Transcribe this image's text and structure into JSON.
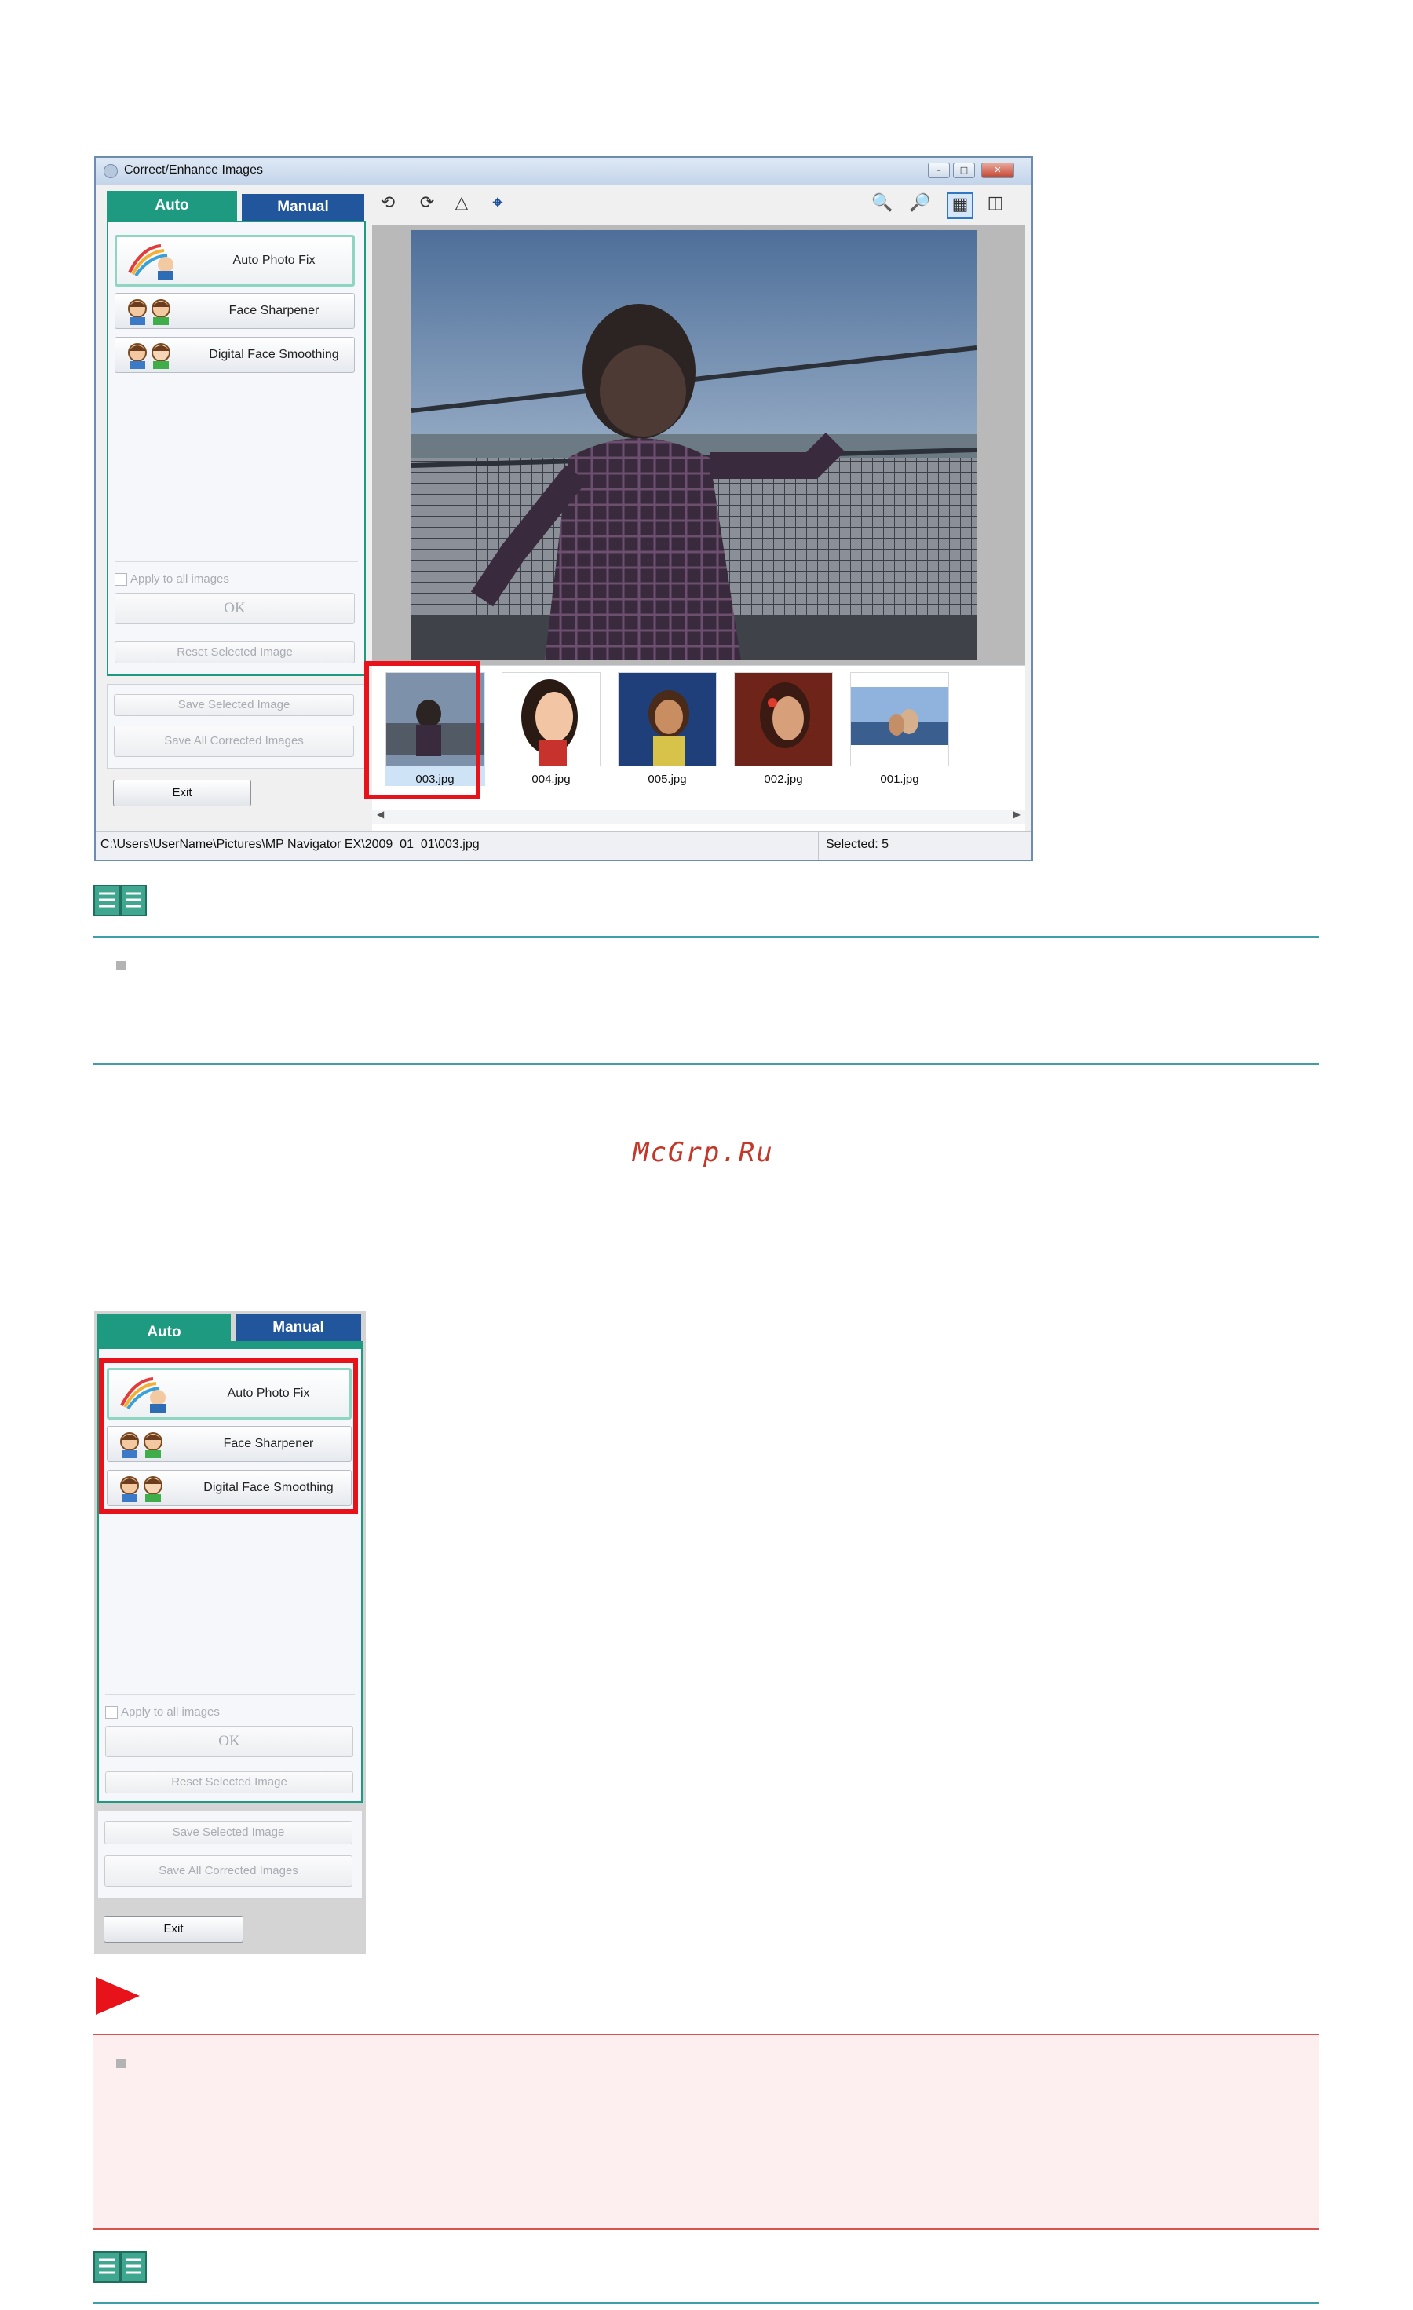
{
  "window": {
    "title": "Correct/Enhance Images",
    "tabs": {
      "auto": "Auto",
      "manual": "Manual"
    },
    "buttons": {
      "auto_photo_fix": "Auto Photo Fix",
      "face_sharpener": "Face Sharpener",
      "digital_face_smoothing": "Digital Face Smoothing",
      "apply_all": "Apply to all images",
      "ok": "OK",
      "reset": "Reset Selected Image",
      "save_selected": "Save Selected Image",
      "save_all": "Save All Corrected Images",
      "exit": "Exit"
    },
    "thumbnails": [
      "003.jpg",
      "004.jpg",
      "005.jpg",
      "002.jpg",
      "001.jpg"
    ],
    "status_path": "C:\\Users\\UserName\\Pictures\\MP Navigator EX\\2009_01_01\\003.jpg",
    "status_selected": "Selected: 5"
  },
  "watermark": "McGrp.Ru",
  "colors": {
    "auto_tab": "#1d9a80",
    "manual_tab": "#21559c",
    "highlight": "#e8121b",
    "note_line": "#3f9ea8",
    "important_line": "#d9534f"
  },
  "icons": [
    "note-book-icon",
    "important-flag-icon",
    "rotate-left-icon",
    "rotate-right-icon",
    "flip-icon",
    "crop-icon",
    "zoom-in-icon",
    "zoom-out-icon",
    "whole-image-view-icon",
    "compare-view-icon"
  ]
}
